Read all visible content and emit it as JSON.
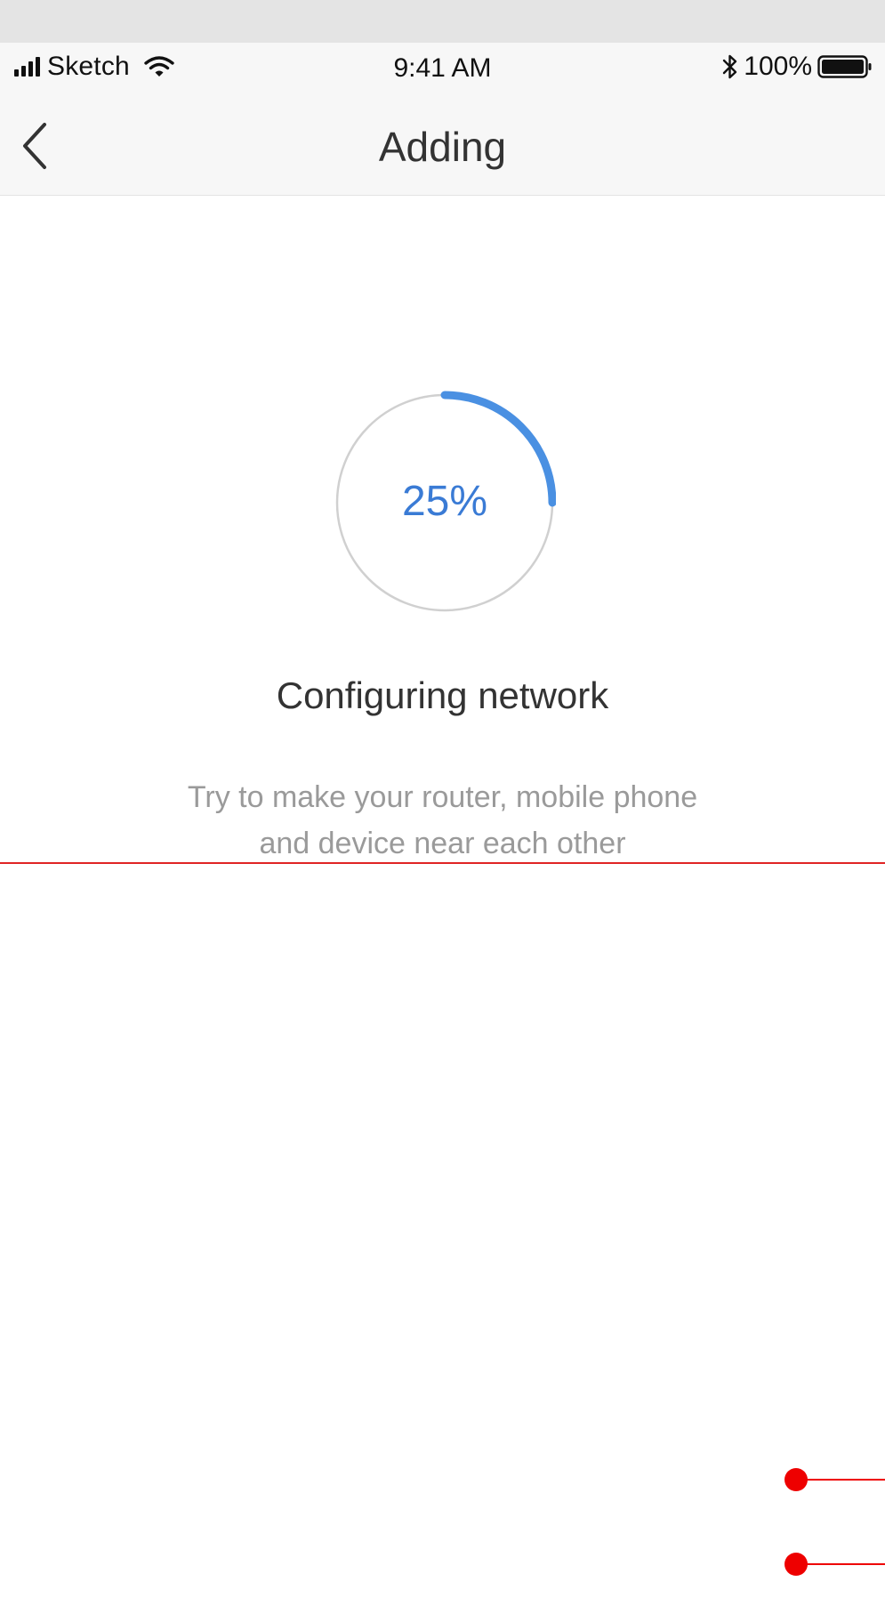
{
  "status_bar": {
    "carrier": "Sketch",
    "time": "9:41 AM",
    "battery": "100%",
    "icons": [
      "signal-icon",
      "wifi-icon",
      "bluetooth-icon",
      "battery-icon"
    ]
  },
  "nav": {
    "title": "Adding",
    "back_icon": "chevron-left-icon"
  },
  "progress": {
    "value": 25,
    "label": "25%",
    "track_color": "#d0d0d0",
    "fill_color": "#4a90e2",
    "text_color": "#3a7bd5"
  },
  "status": {
    "title": "Configuring network",
    "hint_line1": "Try to make your router, mobile phone",
    "hint_line2": "and device near each other"
  },
  "colors": {
    "annotation_red": "#ee0000"
  }
}
